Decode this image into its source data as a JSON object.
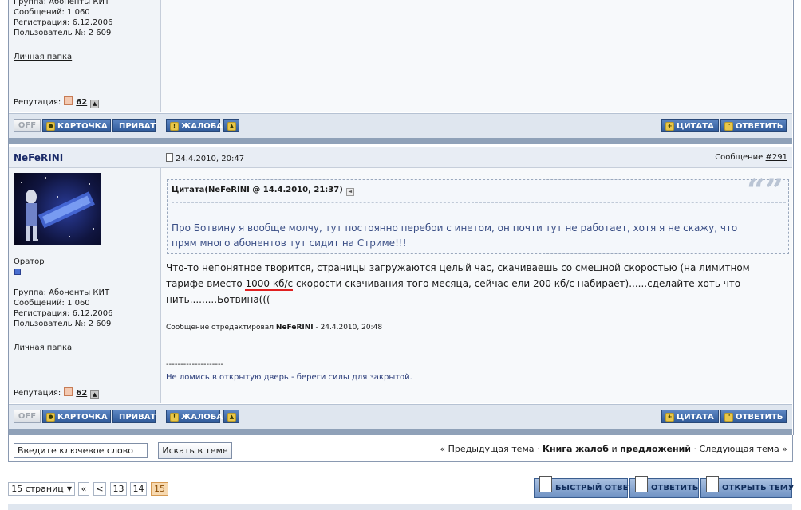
{
  "post1": {
    "group": "Группа: Абоненты КИТ",
    "messages": "Сообщений: 1 060",
    "registered": "Регистрация: 6.12.2006",
    "user_no": "Пользователь №: 2 609",
    "folder_link": "Личная папка",
    "rep_label": "Репутация:",
    "rep_value": "62"
  },
  "buttons": {
    "off": "OFF",
    "card": "КАРТОЧКА",
    "private": "ПРИВАТ",
    "complaint": "ЖАЛОБА",
    "quote": "ЦИТАТА",
    "reply": "ОТВЕТИТЬ"
  },
  "post2": {
    "author": "NeFeRINI",
    "date": "24.4.2010, 20:47",
    "message_label": "Сообщение",
    "message_no": "#291",
    "rank": "Оратор",
    "group": "Группа: Абоненты КИТ",
    "messages": "Сообщений: 1 060",
    "registered": "Регистрация: 6.12.2006",
    "user_no": "Пользователь №: 2 609",
    "folder_link": "Личная папка",
    "rep_label": "Репутация:",
    "rep_value": "62",
    "quote_header": "Цитата(NeFeRINI @ 14.4.2010, 21:37)",
    "quote_line1": "Про Ботвину я вообще молчу, тут постоянно перебои с инетом, он почти тут не работает, хотя я не скажу, что",
    "quote_line2": "прям много абонентов тут сидит на Стриме!!!",
    "body_line1": "Что-то непонятное творится, страницы загружаются целый час, скачиваешь со смешной скоростью (на лимитном",
    "body_line2a": "тарифе вместо ",
    "body_line2b": "1000 кб/с",
    "body_line2c": " скорости скачивания того месяца, сейчас ели 200 кб/с набирает)......сделайте хоть что",
    "body_line3": "нить.........Ботвина(((",
    "edited_prefix": "Сообщение отредактировал ",
    "edited_user": "NeFeRINI",
    "edited_suffix": " - 24.4.2010, 20:48",
    "sig_dashes": "--------------------",
    "signature": "Не ломись в открытую дверь - береги силы для закрытой."
  },
  "search": {
    "value": "Введите ключевое слово",
    "button": "Искать в теме"
  },
  "topic_nav": {
    "prev": "« Предыдущая тема",
    "sep1": " · ",
    "forum_a": "Книга жалоб",
    "and": " и ",
    "forum_b": "предложений",
    "sep2": " · ",
    "next": "Следующая тема »"
  },
  "pagination": {
    "pages_label": "15 страниц",
    "first": "«",
    "prev": "<",
    "pages": [
      "13",
      "14",
      "15"
    ],
    "current": "15"
  },
  "actions": {
    "fast_reply": "БЫСТРЫЙ ОТВЕТ",
    "reply": "ОТВЕТИТЬ",
    "new_topic": "ОТКРЫТЬ ТЕМУ"
  }
}
